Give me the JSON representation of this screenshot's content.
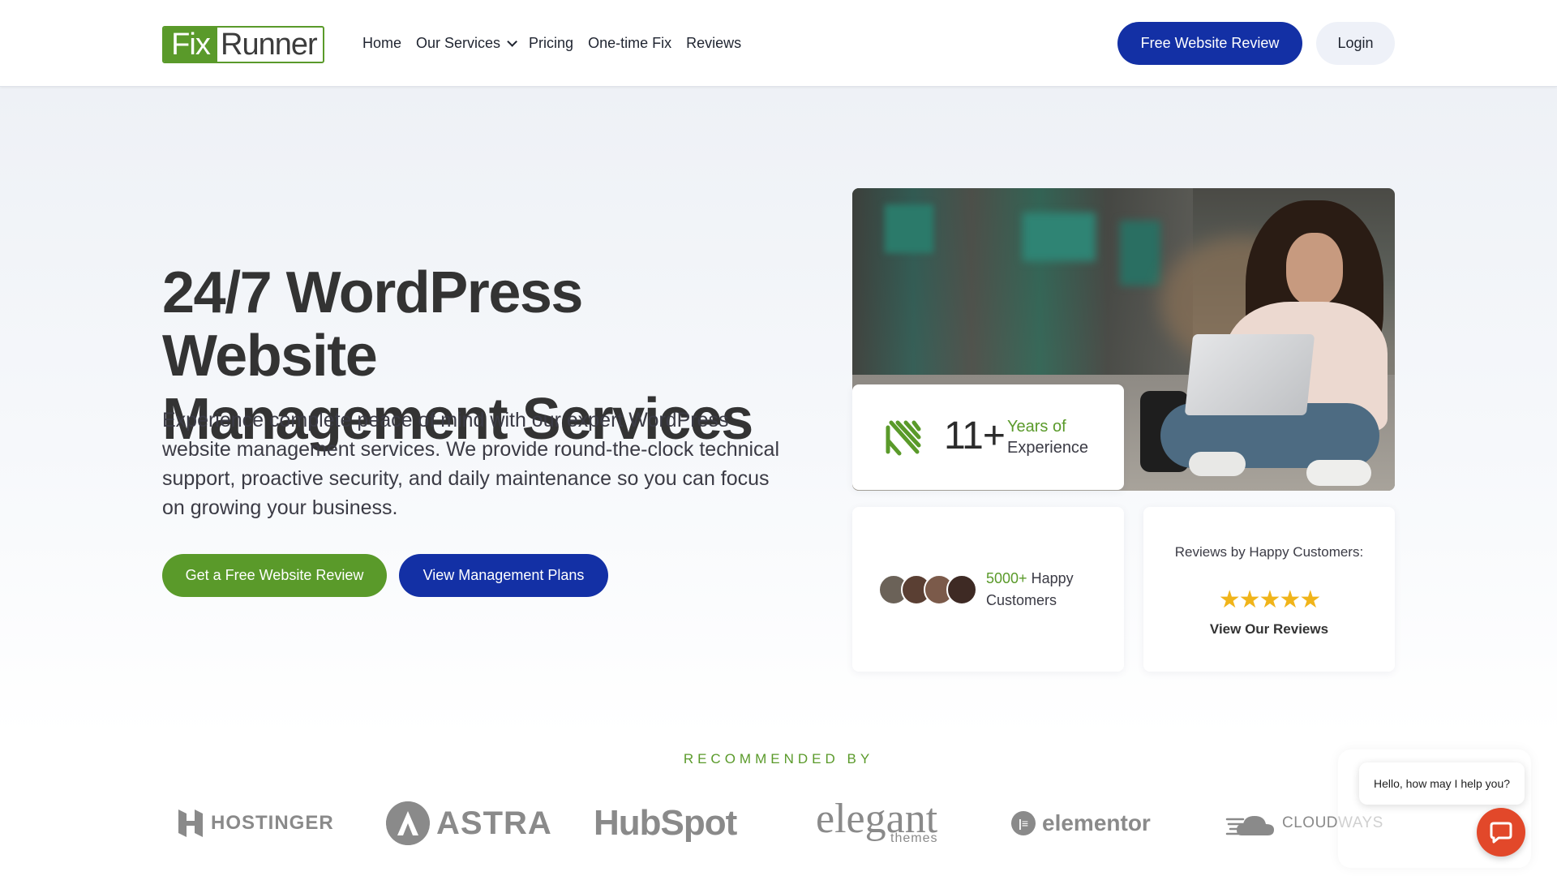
{
  "brand": {
    "logo_fix": "Fix",
    "logo_runner": "Runner",
    "green": "#5a9a2a",
    "blue": "#1330a5"
  },
  "nav": {
    "items": [
      "Home",
      "Our Services",
      "Pricing",
      "One-time Fix",
      "Reviews"
    ]
  },
  "header": {
    "review_button": "Free Website Review",
    "login_button": "Login"
  },
  "hero": {
    "title_line1": "24/7 WordPress Website",
    "title_line2": "Management Services",
    "description": "Experience complete peace of mind with our expert WordPress website management services. We provide round-the-clock technical support, proactive security, and daily maintenance so you can focus on growing your business.",
    "primary_button": "Get a Free Website Review",
    "secondary_button": "View Management Plans"
  },
  "stats": {
    "experience_number": "11+",
    "experience_label1": "Years of",
    "experience_label2": "Experience",
    "customers_count": "5000+",
    "customers_label1": "Happy",
    "customers_label2": "Customers",
    "reviews_title": "Reviews by Happy Customers:",
    "stars": "★★★★★",
    "rating_stars": 5,
    "reviews_link": "View Our Reviews"
  },
  "recommended": {
    "label": "RECOMMENDED BY",
    "partners": [
      "HOSTINGER",
      "ASTRA",
      "HubSpot",
      "elegant",
      "themes",
      "elementor",
      "CLOUDWAYS"
    ]
  },
  "chat": {
    "greeting": "Hello, how may I help you?",
    "icon": "chat-icon",
    "color": "#e2482a"
  }
}
